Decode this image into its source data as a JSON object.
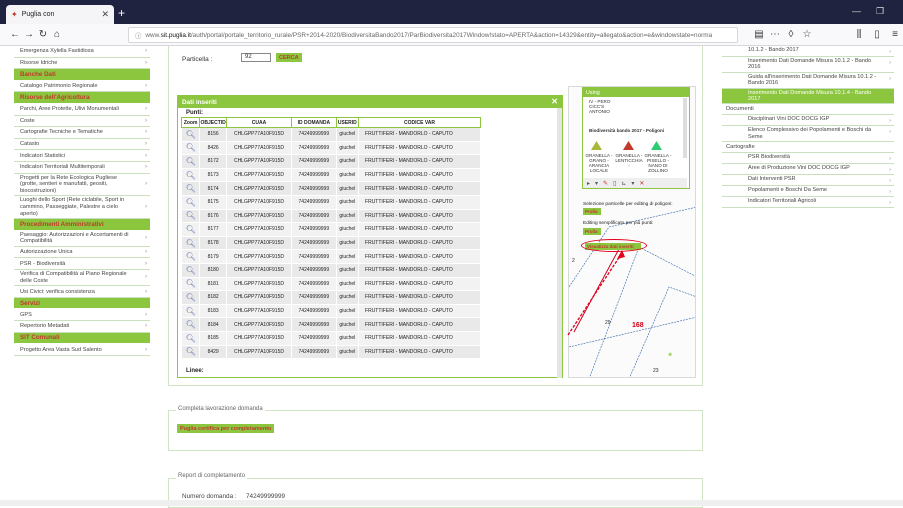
{
  "browser": {
    "tab_title": "Puglia con",
    "url_prefix": "www.",
    "url_domain": "sit.puglia.it",
    "url_rest": "/auth/portal/portale_territorio_rurale/PSR+2014-2020/BiodiversitaBando2017/ParBiodiversita2017Window!stato=APERTA&action=14329&entity=allegato&action=e&windowstate=norma"
  },
  "sidebar": {
    "items": [
      {
        "type": "item",
        "label": "Emergenza Xylella Fastidiosa"
      },
      {
        "type": "item",
        "label": "Risorse Idriche"
      },
      {
        "type": "head",
        "label": "Banche Dati"
      },
      {
        "type": "item",
        "label": "Catalogo Patrimonio Regionale"
      },
      {
        "type": "head",
        "label": "Risorse dell'Agricoltura"
      },
      {
        "type": "item",
        "label": "Parchi, Aree Protette, Ulivi Monumentali"
      },
      {
        "type": "item",
        "label": "Coste"
      },
      {
        "type": "item",
        "label": "Cartografie Tecniche e Tematiche"
      },
      {
        "type": "item",
        "label": "Catasto"
      },
      {
        "type": "item",
        "label": "Indicatori Statistici"
      },
      {
        "type": "item",
        "label": "Indicatori Territoriali Multitemporali"
      },
      {
        "type": "tall",
        "label": "Progetti per la Rete Ecologica Pugliese (grotte, sentieri e manufatti, geositi, biocostruzioni)"
      },
      {
        "type": "tall",
        "label": "Luoghi dello Sport (Rete ciclabile, Sport in cammino, Passeggiate, Palestre a cielo aperto)"
      },
      {
        "type": "head",
        "label": "Procedimenti Amministrativi"
      },
      {
        "type": "tall",
        "label": "Paesaggio: Autorizzazioni e Accertamenti di Compatibilità"
      },
      {
        "type": "item",
        "label": "Autorizzazione Unica"
      },
      {
        "type": "item",
        "label": "PSR - Biodiversità"
      },
      {
        "type": "tall",
        "label": "Verifica di Compatibilità al Piano Regionale delle Coste"
      },
      {
        "type": "item",
        "label": "Usi Civici: verifica consistenza"
      },
      {
        "type": "head",
        "label": "Servizi"
      },
      {
        "type": "item",
        "label": "GPS"
      },
      {
        "type": "item",
        "label": "Repertorio Metadati"
      },
      {
        "type": "head",
        "label": "SIT Comunali"
      },
      {
        "type": "item",
        "label": "Progetto Area Vasta Sud Salento"
      }
    ]
  },
  "form": {
    "particella_label": "Particella :",
    "particella_value": "92",
    "cerca_label": "CERCA"
  },
  "dialog": {
    "title": "Dati inseriti",
    "punti_label": "Punti:",
    "linee_label": "Linee:",
    "columns": [
      "Zoom",
      "OBJECTID",
      "CUAA",
      "ID DOMANDA",
      "USERID",
      "CODICE VAR"
    ],
    "rows": [
      [
        "8156",
        "CHLGPP77A10F915D",
        "74249999999",
        "giuchel",
        "FRUTTIFERI - MANDORLO - CAPUTO"
      ],
      [
        "8426",
        "CHLGPP77A10F915D",
        "74249999999",
        "giuchel",
        "FRUTTIFERI - MANDORLO - CAPUTO"
      ],
      [
        "8172",
        "CHLGPP77A10F915D",
        "74249999999",
        "giuchel",
        "FRUTTIFERI - MANDORLO - CAPUTO"
      ],
      [
        "8173",
        "CHLGPP77A10F915D",
        "74249999999",
        "giuchel",
        "FRUTTIFERI - MANDORLO - CAPUTO"
      ],
      [
        "8174",
        "CHLGPP77A10F915D",
        "74249999999",
        "giuchel",
        "FRUTTIFERI - MANDORLO - CAPUTO"
      ],
      [
        "8175",
        "CHLGPP77A10F915D",
        "74249999999",
        "giuchel",
        "FRUTTIFERI - MANDORLO - CAPUTO"
      ],
      [
        "8176",
        "CHLGPP77A10F915D",
        "74249999999",
        "giuchel",
        "FRUTTIFERI - MANDORLO - CAPUTO"
      ],
      [
        "8177",
        "CHLGPP77A10F915D",
        "74249999999",
        "giuchel",
        "FRUTTIFERI - MANDORLO - CAPUTO"
      ],
      [
        "8178",
        "CHLGPP77A10F915D",
        "74249999999",
        "giuchel",
        "FRUTTIFERI - MANDORLO - CAPUTO"
      ],
      [
        "8179",
        "CHLGPP77A10F915D",
        "74249999999",
        "giuchel",
        "FRUTTIFERI - MANDORLO - CAPUTO"
      ],
      [
        "8180",
        "CHLGPP77A10F915D",
        "74249999999",
        "giuchel",
        "FRUTTIFERI - MANDORLO - CAPUTO"
      ],
      [
        "8181",
        "CHLGPP77A10F915D",
        "74249999999",
        "giuchel",
        "FRUTTIFERI - MANDORLO - CAPUTO"
      ],
      [
        "8182",
        "CHLGPP77A10F915D",
        "74249999999",
        "giuchel",
        "FRUTTIFERI - MANDORLO - CAPUTO"
      ],
      [
        "8183",
        "CHLGPP77A10F915D",
        "74249999999",
        "giuchel",
        "FRUTTIFERI - MANDORLO - CAPUTO"
      ],
      [
        "8184",
        "CHLGPP77A10F915D",
        "74249999999",
        "giuchel",
        "FRUTTIFERI - MANDORLO - CAPUTO"
      ],
      [
        "8185",
        "CHLGPP77A10F915D",
        "74249999999",
        "giuchel",
        "FRUTTIFERI - MANDORLO - CAPUTO"
      ],
      [
        "8429",
        "CHLGPP77A10F915D",
        "74249999999",
        "giuchel",
        "FRUTTIFERI - MANDORLO - CAPUTO"
      ]
    ]
  },
  "map": {
    "legend_title": "Using",
    "legend_top_text": "IV - PERO CICC'S ANTONIO",
    "legend_bando": "Biodiversità bando 2017 - Poligoni",
    "legend_items": [
      {
        "label": "GRANELLA - GRANO - ARANCIA LOCALE",
        "color": "#a9b83a"
      },
      {
        "label": "GRANELLA - LENTICCHIA -",
        "color": "#c0392b"
      },
      {
        "label": "GRANELLA - PISELLO - NANO DI ZOLLINO",
        "color": "#2ecc71"
      }
    ],
    "selezione_text": "Selezione particelle per editing di poligoni:",
    "selezione_btn": "Prulla",
    "editing_text": "Editing semplificato per più punti:",
    "editing_btn": "Prulla",
    "visualizza_btn": "Visualizza dati inseriti",
    "label_2": "2",
    "label_29": "29",
    "label_168": "168",
    "label_23": "23"
  },
  "rightbar": {
    "items": [
      {
        "type": "item",
        "label": "10.1.2 - Bando 2017"
      },
      {
        "type": "item",
        "label": "Inserimento Dati Domande Misura 10.1.2 - Bando 2016"
      },
      {
        "type": "item",
        "label": "Guida all'inserimento Dati Domande Misura 10.1.2 - Bando 2016"
      },
      {
        "type": "hl",
        "label": "Inserimento Dati Domande Misura 10.1.4 - Bando 2017"
      },
      {
        "type": "cat",
        "label": "Documenti"
      },
      {
        "type": "item",
        "label": "Disciplinari Vini DOC DOCG IGP"
      },
      {
        "type": "item",
        "label": "Elenco Complessivo dei Popolamenti e Boschi da Seme"
      },
      {
        "type": "cat",
        "label": "Cartografie"
      },
      {
        "type": "item",
        "label": "PSR Biodiversità"
      },
      {
        "type": "item",
        "label": "Aree di Produzione Vini DOC DOCG IGP"
      },
      {
        "type": "item",
        "label": "Dati Interventi PSR"
      },
      {
        "type": "item",
        "label": "Popolamenti e Boschi Da Seme"
      },
      {
        "type": "item",
        "label": "Indicatori Territoriali Agricoli"
      }
    ]
  },
  "completa": {
    "legend": "Completa lavorazione domanda",
    "button": "Puglia certifica per completamento"
  },
  "report": {
    "legend": "Report di completamento",
    "numero_label": "Numero domanda :",
    "numero_value": "74249999999"
  }
}
